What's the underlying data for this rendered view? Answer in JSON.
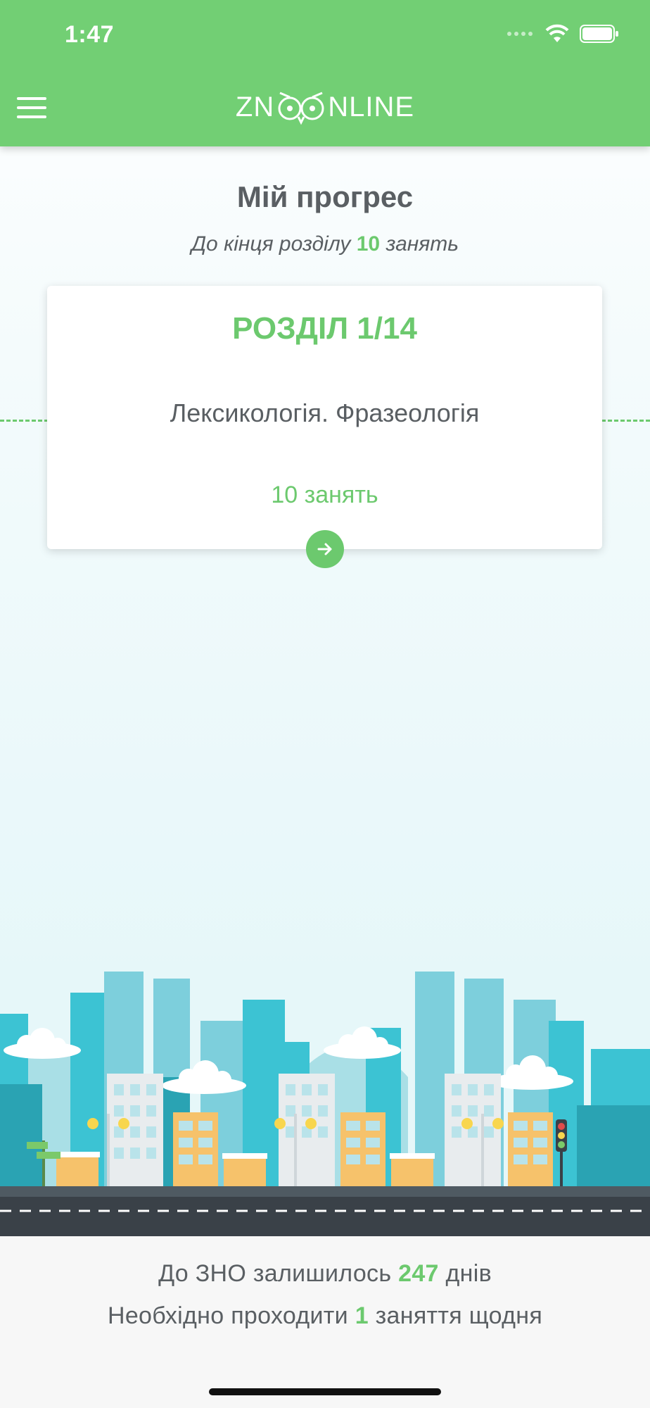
{
  "status": {
    "time": "1:47"
  },
  "header": {
    "menu_icon": "hamburger-menu-icon",
    "logo_left": "ZN",
    "logo_right": "NLINE"
  },
  "progress": {
    "title": "Мій прогрес",
    "subtitle_prefix": "До кінця розділу",
    "subtitle_count": "10",
    "subtitle_suffix": "занять"
  },
  "card": {
    "section_label": "РОЗДІЛ 1/14",
    "topic": "Лексикологія. Фразеологія",
    "lessons": "10 занять",
    "button_icon": "arrow-right-icon"
  },
  "footer": {
    "line1_prefix": "До ЗНО залишилось",
    "line1_days": "247",
    "line1_suffix": "днів",
    "line2_prefix": "Необхідно проходити",
    "line2_count": "1",
    "line2_suffix": "заняття щодня"
  },
  "colors": {
    "accent": "#72cf74",
    "text": "#5a5f63"
  }
}
